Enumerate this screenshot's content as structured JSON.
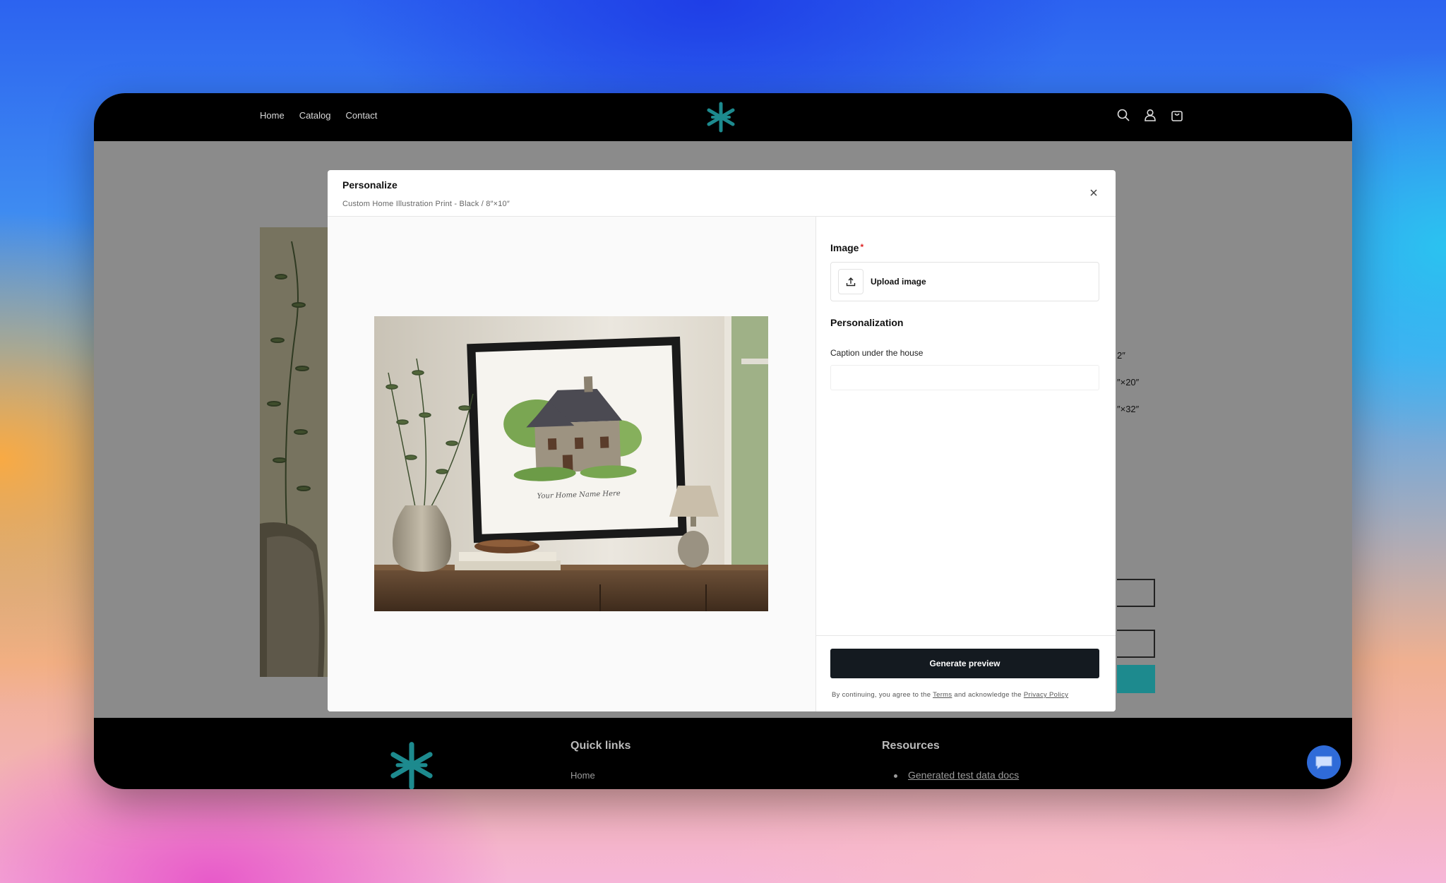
{
  "nav": {
    "items": [
      {
        "label": "Home"
      },
      {
        "label": "Catalog"
      },
      {
        "label": "Contact"
      }
    ]
  },
  "header_icons": [
    "search-icon",
    "account-icon",
    "cart-icon"
  ],
  "brand_color": "#1d8a8e",
  "background_page": {
    "variants": [
      "2″",
      "″×20″",
      "″×32″"
    ]
  },
  "modal": {
    "title": "Personalize",
    "subtitle": "Custom Home Illustration Print - Black / 8″×10″",
    "image_section": {
      "label": "Image",
      "required_mark": "*",
      "upload_label": "Upload image"
    },
    "personalization": {
      "heading": "Personalization",
      "caption_label": "Caption under the house",
      "caption_value": "",
      "caption_placeholder": ""
    },
    "generate_label": "Generate preview",
    "legal": {
      "prefix": "By continuing, you agree to the",
      "terms": "Terms",
      "middle": "and acknowledge the",
      "privacy": "Privacy Policy"
    },
    "preview_caption": "Your Home Name Here"
  },
  "footer": {
    "quick_links_heading": "Quick links",
    "quick_links": [
      {
        "label": "Home"
      }
    ],
    "resources_heading": "Resources",
    "resources": [
      {
        "label": "Generated test data docs"
      }
    ]
  }
}
